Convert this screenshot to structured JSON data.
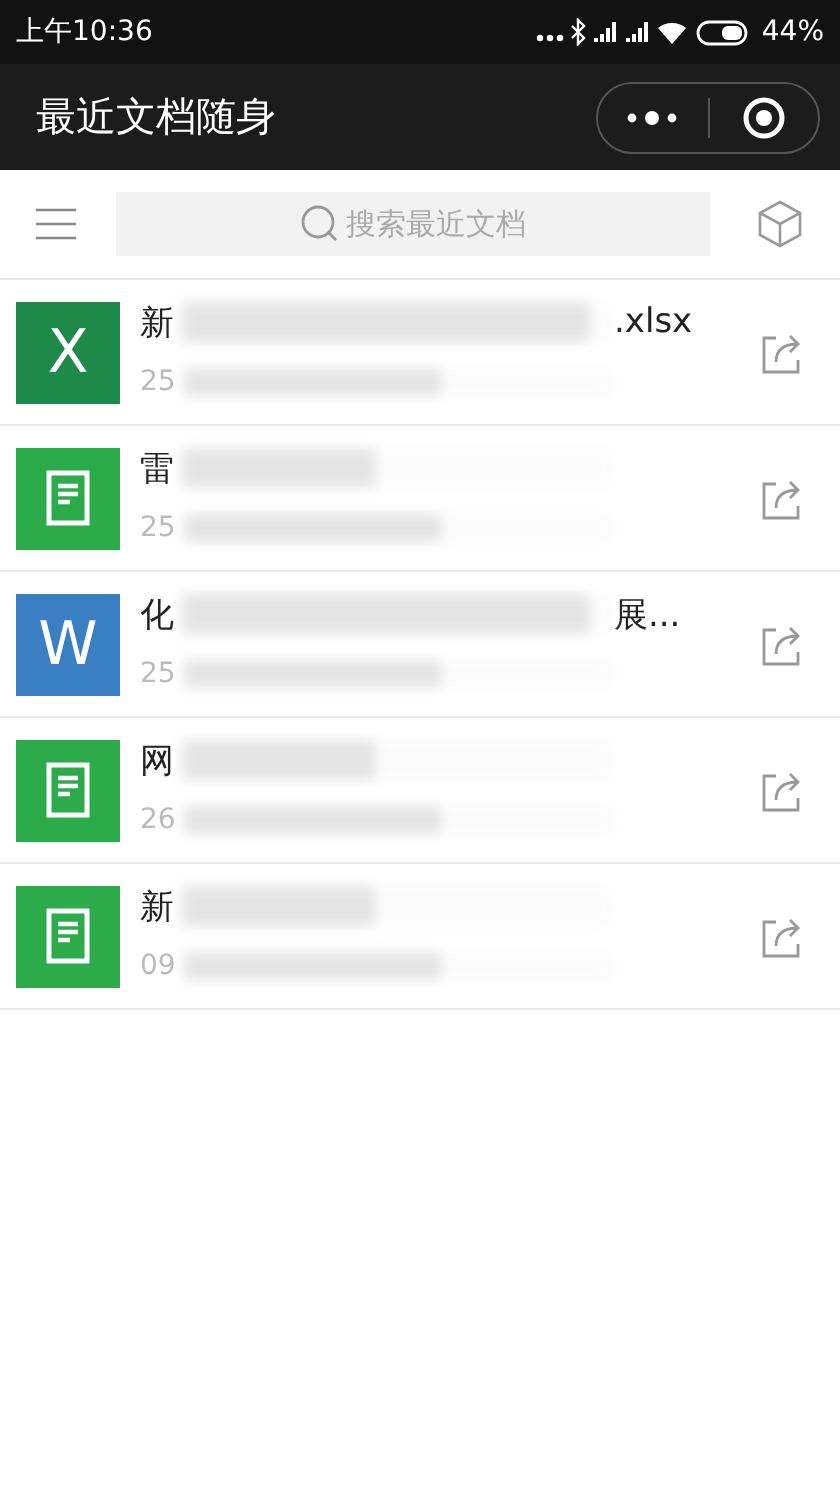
{
  "status_bar": {
    "time": "上午10:36",
    "battery": "44%"
  },
  "title_bar": {
    "title": "最近文档随身"
  },
  "search": {
    "placeholder": "搜索最近文档"
  },
  "files": [
    {
      "kind": "excel",
      "badge": "X",
      "name_start": "新",
      "name_end": ".xlsx",
      "meta_start": "25"
    },
    {
      "kind": "text",
      "name_start": "雷",
      "meta_start": "25"
    },
    {
      "kind": "word",
      "badge": "W",
      "name_start": "化",
      "name_end": "展...",
      "meta_start": "25"
    },
    {
      "kind": "text",
      "name_start": "网",
      "meta_start": "26"
    },
    {
      "kind": "text",
      "name_start": "新",
      "meta_start": "09"
    }
  ]
}
